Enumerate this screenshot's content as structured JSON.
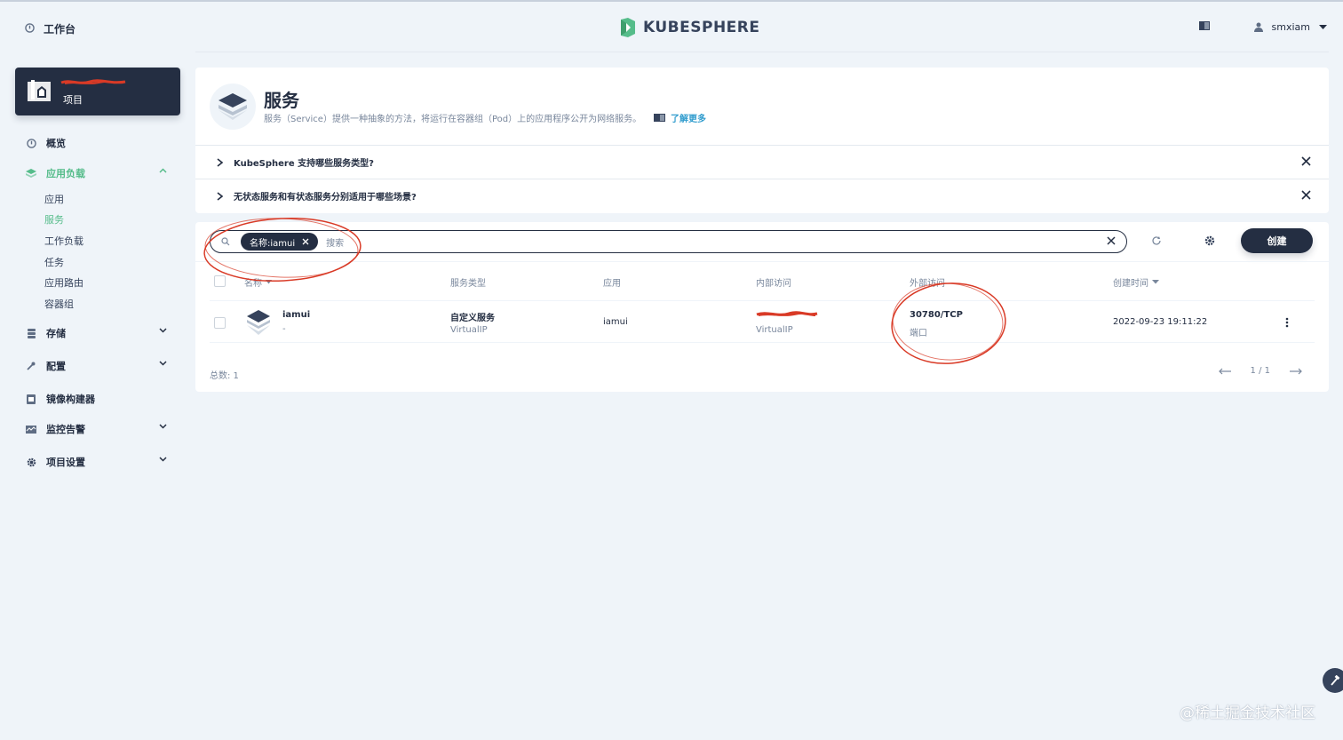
{
  "topbar": {
    "workbench_label": "工作台",
    "logo_text": "KUBESPHERE",
    "username": "smxiam"
  },
  "project_card": {
    "label": "项目"
  },
  "nav": {
    "overview": "概览",
    "app_workloads": "应用负载",
    "sub": [
      "应用",
      "服务",
      "工作负载",
      "任务",
      "应用路由",
      "容器组"
    ],
    "storage": "存储",
    "config": "配置",
    "image_builder": "镜像构建器",
    "monitoring": "监控告警",
    "project_settings": "项目设置"
  },
  "header": {
    "title": "服务",
    "description": "服务（Service）提供一种抽象的方法，将运行在容器组（Pod）上的应用程序公开为网络服务。",
    "learn_more": "了解更多"
  },
  "faq": [
    "KubeSphere 支持哪些服务类型?",
    "无状态服务和有状态服务分别适用于哪些场景?"
  ],
  "toolbar": {
    "filter_tag": "名称:iamui",
    "search_placeholder": "搜索",
    "create_label": "创建"
  },
  "table": {
    "columns": [
      "名称",
      "服务类型",
      "应用",
      "内部访问",
      "外部访问",
      "创建时间"
    ],
    "rows": [
      {
        "name": "iamui",
        "name_sub": "-",
        "type": "自定义服务",
        "type_sub": "VirtualIP",
        "app": "iamui",
        "internal_sub": "VirtualIP",
        "external": "30780/TCP",
        "external_sub": "端口",
        "created": "2022-09-23 19:11:22"
      }
    ]
  },
  "footer": {
    "total": "总数: 1",
    "page": "1 / 1"
  },
  "watermark": "@稀土掘金技术社区",
  "colors": {
    "accent_green": "#55bc8a",
    "dark": "#242e42",
    "link": "#329dce",
    "annotation_red": "#d93a26"
  }
}
